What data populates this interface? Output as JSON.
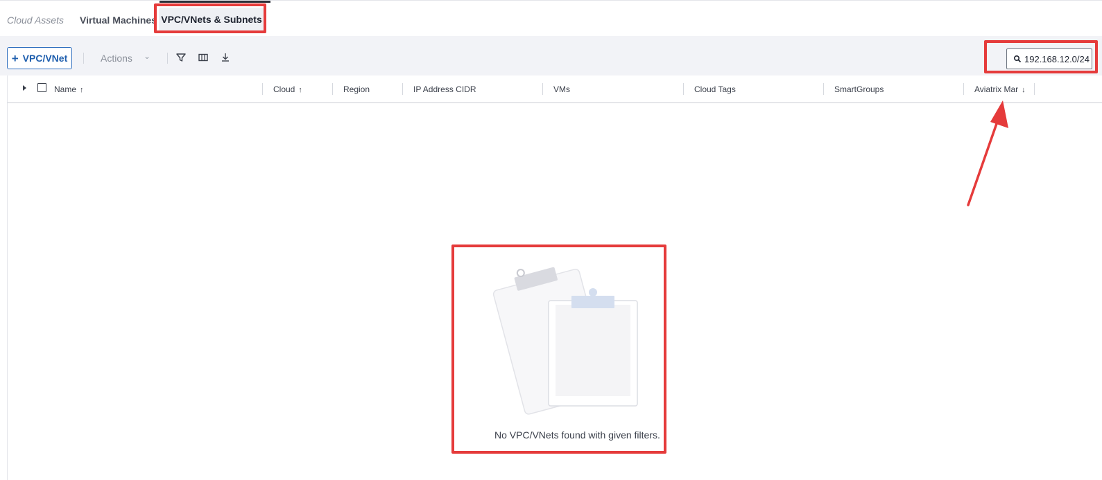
{
  "tabs": {
    "root": "Cloud Assets",
    "virtual_machines": "Virtual Machines",
    "active": "VPC/VNets & Subnets"
  },
  "toolbar": {
    "add_label": "VPC/VNet",
    "add_icon": "plus-icon",
    "actions_label": "Actions",
    "filter_icon": "filter-icon",
    "columns_icon": "columns-icon",
    "download_icon": "download-icon",
    "search_value": "192.168.12.0/24",
    "search_icon": "search-icon"
  },
  "table": {
    "columns": [
      {
        "label": "Name",
        "sort": "↑"
      },
      {
        "label": "Cloud",
        "sort": "↑"
      },
      {
        "label": "Region",
        "sort": ""
      },
      {
        "label": "IP Address CIDR",
        "sort": ""
      },
      {
        "label": "VMs",
        "sort": ""
      },
      {
        "label": "Cloud Tags",
        "sort": ""
      },
      {
        "label": "SmartGroups",
        "sort": ""
      },
      {
        "label": "Aviatrix Mar",
        "sort": "↓"
      }
    ]
  },
  "empty_state": {
    "message": "No VPC/VNets found with given filters.",
    "illustration": "clipboards-illustration"
  },
  "colors": {
    "accent": "#1f5fae",
    "annotation": "#e53b3b",
    "toolbar_bg": "#f2f3f7"
  }
}
